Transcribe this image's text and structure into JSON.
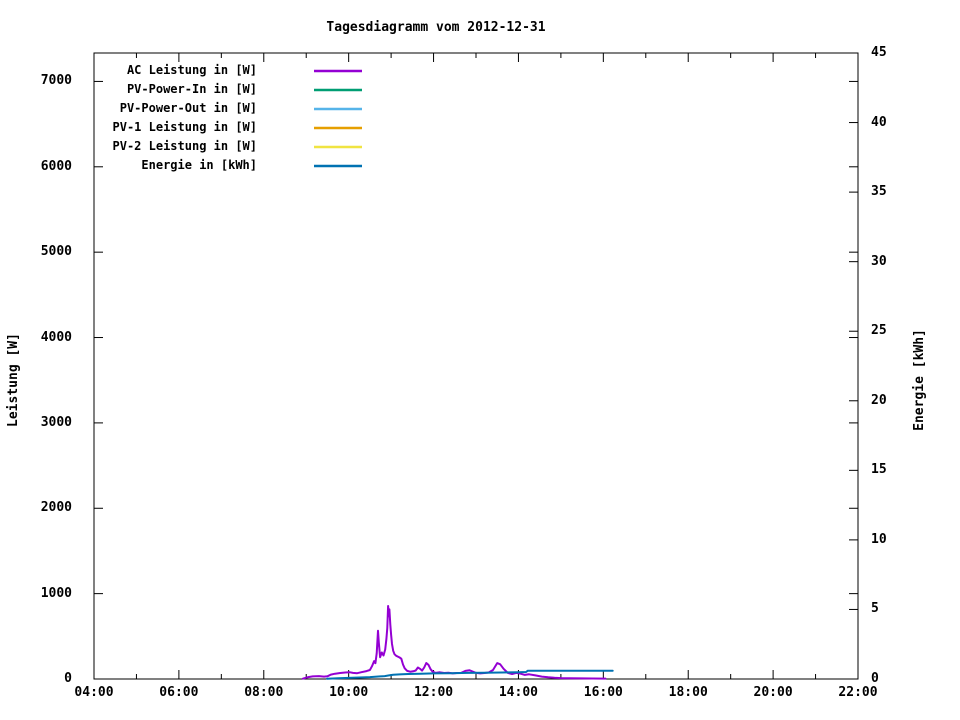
{
  "title": "Tagesdiagramm vom 2012-12-31",
  "chart_data": {
    "type": "line",
    "title": "Tagesdiagramm vom 2012-12-31",
    "grid": false,
    "legend_position": "top-left-inside",
    "x_axis": {
      "unit": "time",
      "range_hours": [
        4,
        22
      ],
      "major_ticks": [
        {
          "hour": 4,
          "label": "04:00"
        },
        {
          "hour": 6,
          "label": "06:00"
        },
        {
          "hour": 8,
          "label": "08:00"
        },
        {
          "hour": 10,
          "label": "10:00"
        },
        {
          "hour": 12,
          "label": "12:00"
        },
        {
          "hour": 14,
          "label": "14:00"
        },
        {
          "hour": 16,
          "label": "16:00"
        },
        {
          "hour": 18,
          "label": "18:00"
        },
        {
          "hour": 20,
          "label": "20:00"
        },
        {
          "hour": 22,
          "label": "22:00"
        }
      ],
      "minor_tick_hours": [
        5,
        7,
        9,
        11,
        13,
        15,
        17,
        19,
        21
      ]
    },
    "y_left": {
      "label": "Leistung [W]",
      "range": [
        0,
        7333
      ],
      "ticks": [
        {
          "value": 0,
          "label": "0"
        },
        {
          "value": 1000,
          "label": "1000"
        },
        {
          "value": 2000,
          "label": "2000"
        },
        {
          "value": 3000,
          "label": "3000"
        },
        {
          "value": 4000,
          "label": "4000"
        },
        {
          "value": 5000,
          "label": "5000"
        },
        {
          "value": 6000,
          "label": "6000"
        },
        {
          "value": 7000,
          "label": "7000"
        }
      ]
    },
    "y_right": {
      "label": "Energie [kWh]",
      "range": [
        0,
        45
      ],
      "ticks": [
        {
          "value": 0,
          "label": "0"
        },
        {
          "value": 5,
          "label": "5"
        },
        {
          "value": 10,
          "label": "10"
        },
        {
          "value": 15,
          "label": "15"
        },
        {
          "value": 20,
          "label": "20"
        },
        {
          "value": 25,
          "label": "25"
        },
        {
          "value": 30,
          "label": "30"
        },
        {
          "value": 35,
          "label": "35"
        },
        {
          "value": 40,
          "label": "40"
        },
        {
          "value": 45,
          "label": "45"
        }
      ]
    },
    "series": [
      {
        "name": "AC Leistung in [W]",
        "color": "#9400d3",
        "axis": "left",
        "points": [
          [
            8.92,
            4
          ],
          [
            9.05,
            22
          ],
          [
            9.15,
            30
          ],
          [
            9.3,
            34
          ],
          [
            9.42,
            28
          ],
          [
            9.5,
            32
          ],
          [
            9.58,
            52
          ],
          [
            9.68,
            62
          ],
          [
            9.8,
            70
          ],
          [
            9.92,
            76
          ],
          [
            10.02,
            80
          ],
          [
            10.1,
            72
          ],
          [
            10.2,
            68
          ],
          [
            10.3,
            80
          ],
          [
            10.42,
            92
          ],
          [
            10.5,
            105
          ],
          [
            10.55,
            150
          ],
          [
            10.6,
            210
          ],
          [
            10.63,
            185
          ],
          [
            10.66,
            300
          ],
          [
            10.69,
            565
          ],
          [
            10.71,
            430
          ],
          [
            10.74,
            255
          ],
          [
            10.78,
            310
          ],
          [
            10.82,
            275
          ],
          [
            10.86,
            345
          ],
          [
            10.89,
            470
          ],
          [
            10.91,
            600
          ],
          [
            10.93,
            855
          ],
          [
            10.95,
            735
          ],
          [
            10.96,
            815
          ],
          [
            10.98,
            640
          ],
          [
            11.0,
            520
          ],
          [
            11.02,
            410
          ],
          [
            11.05,
            330
          ],
          [
            11.08,
            290
          ],
          [
            11.12,
            272
          ],
          [
            11.16,
            262
          ],
          [
            11.2,
            252
          ],
          [
            11.24,
            238
          ],
          [
            11.28,
            170
          ],
          [
            11.32,
            125
          ],
          [
            11.38,
            95
          ],
          [
            11.45,
            85
          ],
          [
            11.52,
            90
          ],
          [
            11.58,
            100
          ],
          [
            11.63,
            135
          ],
          [
            11.68,
            120
          ],
          [
            11.73,
            98
          ],
          [
            11.78,
            135
          ],
          [
            11.83,
            188
          ],
          [
            11.88,
            165
          ],
          [
            11.93,
            115
          ],
          [
            11.98,
            85
          ],
          [
            12.05,
            72
          ],
          [
            12.15,
            78
          ],
          [
            12.25,
            70
          ],
          [
            12.35,
            74
          ],
          [
            12.45,
            66
          ],
          [
            12.55,
            70
          ],
          [
            12.65,
            72
          ],
          [
            12.75,
            95
          ],
          [
            12.85,
            102
          ],
          [
            12.92,
            88
          ],
          [
            13.0,
            72
          ],
          [
            13.1,
            66
          ],
          [
            13.2,
            70
          ],
          [
            13.3,
            76
          ],
          [
            13.4,
            105
          ],
          [
            13.5,
            186
          ],
          [
            13.57,
            172
          ],
          [
            13.65,
            120
          ],
          [
            13.75,
            72
          ],
          [
            13.85,
            58
          ],
          [
            13.95,
            72
          ],
          [
            14.05,
            62
          ],
          [
            14.15,
            48
          ],
          [
            14.25,
            55
          ],
          [
            14.4,
            42
          ],
          [
            14.55,
            28
          ],
          [
            14.7,
            20
          ],
          [
            14.85,
            14
          ],
          [
            15.0,
            11
          ],
          [
            15.2,
            9
          ],
          [
            15.5,
            7
          ],
          [
            15.75,
            6
          ],
          [
            16.05,
            5
          ]
        ]
      },
      {
        "name": "PV-Power-In in [W]",
        "color": "#009e73",
        "axis": "left",
        "points": []
      },
      {
        "name": "PV-Power-Out in [W]",
        "color": "#56b4e9",
        "axis": "left",
        "points": []
      },
      {
        "name": "PV-1 Leistung in [W]",
        "color": "#e69f00",
        "axis": "left",
        "points": []
      },
      {
        "name": "PV-2 Leistung in [W]",
        "color": "#f0e442",
        "axis": "left",
        "points": []
      },
      {
        "name": "Energie in [kWh]",
        "color": "#0072b2",
        "axis": "right",
        "points": [
          [
            9.49,
            0.02
          ],
          [
            9.75,
            0.05
          ],
          [
            10.0,
            0.08
          ],
          [
            10.25,
            0.11
          ],
          [
            10.5,
            0.14
          ],
          [
            10.7,
            0.18
          ],
          [
            10.85,
            0.21
          ],
          [
            10.95,
            0.26
          ],
          [
            11.05,
            0.3
          ],
          [
            11.2,
            0.33
          ],
          [
            11.4,
            0.36
          ],
          [
            11.7,
            0.38
          ],
          [
            12.0,
            0.4
          ],
          [
            12.4,
            0.42
          ],
          [
            12.8,
            0.44
          ],
          [
            13.2,
            0.45
          ],
          [
            13.6,
            0.47
          ],
          [
            14.0,
            0.49
          ],
          [
            14.18,
            0.5
          ],
          [
            14.22,
            0.6
          ],
          [
            15.0,
            0.6
          ],
          [
            16.0,
            0.6
          ],
          [
            16.22,
            0.6
          ]
        ]
      }
    ]
  }
}
